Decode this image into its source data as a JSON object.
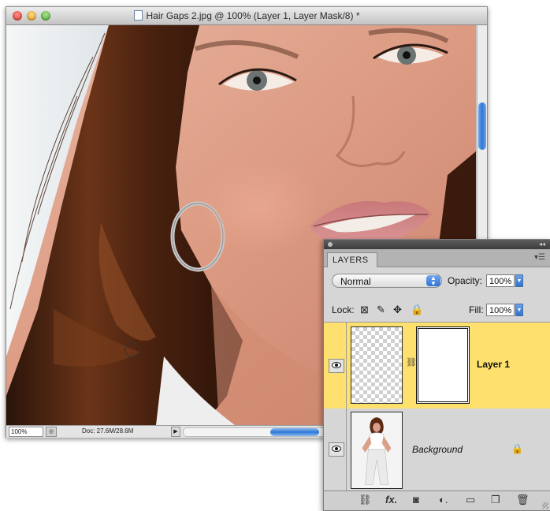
{
  "document": {
    "title": "Hair Gaps 2.jpg @ 100% (Layer 1, Layer Mask/8) *",
    "zoom": "100%",
    "doc_info": "Doc: 27.6M/28.6M",
    "photo_subject": "close-up portrait of woman with long brown hair and hoop earring"
  },
  "layers_panel": {
    "tab_label": "LAYERS",
    "blend_mode": "Normal",
    "opacity_label": "Opacity:",
    "opacity_value": "100%",
    "lock_label": "Lock:",
    "fill_label": "Fill:",
    "fill_value": "100%",
    "layers": [
      {
        "name": "Layer 1",
        "selected": true,
        "visible": true,
        "has_mask": true
      },
      {
        "name": "Background",
        "selected": false,
        "visible": true,
        "locked": true
      }
    ],
    "footer_icons": [
      "link-layers-icon",
      "fx-icon",
      "add-mask-icon",
      "adjustment-layer-icon",
      "new-group-icon",
      "new-layer-icon",
      "trash-icon"
    ],
    "fx_label": "fx"
  },
  "colors": {
    "selected_layer": "#fde06d",
    "scroll_thumb": "#2f78d6"
  }
}
